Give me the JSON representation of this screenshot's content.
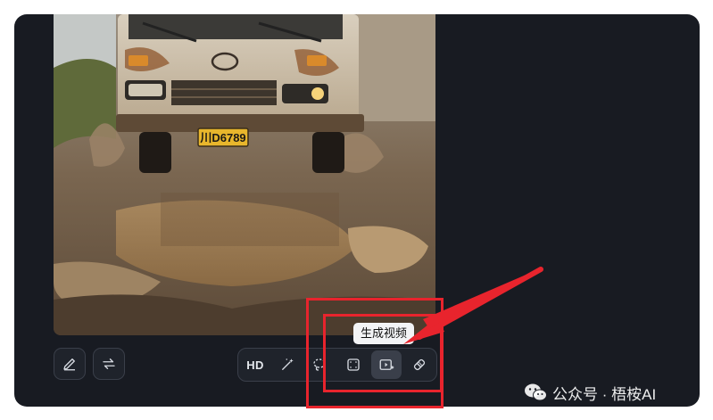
{
  "image": {
    "description_icon": "truck-photo",
    "license_plate": "川D6789"
  },
  "left_actions": [
    {
      "icon": "pencil-icon"
    },
    {
      "icon": "swap-icon"
    }
  ],
  "toolbar": {
    "hd_label": "HD",
    "tools": [
      "magic-wand-icon",
      "lasso-icon",
      "expand-icon",
      "video-generate-icon",
      "eraser-icon"
    ],
    "active_tool": "video-generate-icon"
  },
  "tooltip": {
    "text": "生成视频"
  },
  "annotation": {
    "color": "#e8242d"
  },
  "watermark": {
    "text": "公众号 · 梧桉AI"
  }
}
